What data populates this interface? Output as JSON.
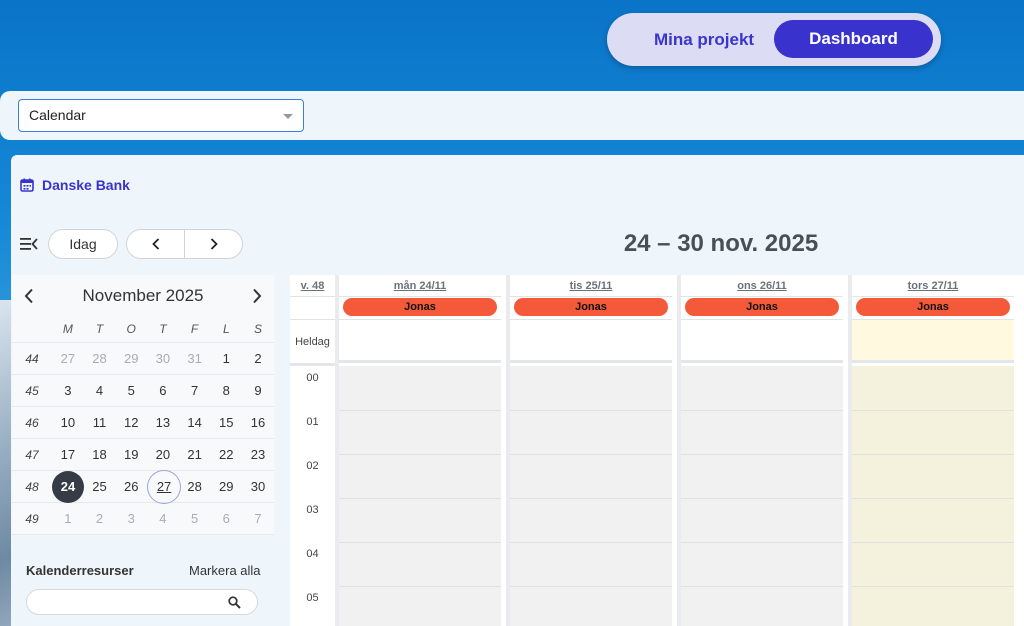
{
  "nav": {
    "projects": "Mina projekt",
    "dashboard": "Dashboard"
  },
  "view_select": {
    "value": "Calendar"
  },
  "org": {
    "name": "Danske Bank"
  },
  "toolbar": {
    "today": "Idag",
    "range_title": "24 – 30 nov. 2025"
  },
  "mini_calendar": {
    "month_label": "November 2025",
    "weekdays": [
      "M",
      "T",
      "O",
      "T",
      "F",
      "L",
      "S"
    ],
    "weeks": [
      {
        "week": "44",
        "days": [
          "27",
          "28",
          "29",
          "30",
          "31",
          "1",
          "2"
        ]
      },
      {
        "week": "45",
        "days": [
          "3",
          "4",
          "5",
          "6",
          "7",
          "8",
          "9"
        ]
      },
      {
        "week": "46",
        "days": [
          "10",
          "11",
          "12",
          "13",
          "14",
          "15",
          "16"
        ]
      },
      {
        "week": "47",
        "days": [
          "17",
          "18",
          "19",
          "20",
          "21",
          "22",
          "23"
        ]
      },
      {
        "week": "48",
        "days": [
          "24",
          "25",
          "26",
          "27",
          "28",
          "29",
          "30"
        ]
      },
      {
        "week": "49",
        "days": [
          "1",
          "2",
          "3",
          "4",
          "5",
          "6",
          "7"
        ]
      }
    ],
    "selected": "24",
    "today": "27"
  },
  "resources": {
    "title": "Kalenderresurser",
    "select_all": "Markera alla"
  },
  "week_view": {
    "week_label": "v. 48",
    "allday_label": "Heldag",
    "days": [
      {
        "label": "mån 24/11",
        "event": "Jonas"
      },
      {
        "label": "tis 25/11",
        "event": "Jonas"
      },
      {
        "label": "ons 26/11",
        "event": "Jonas"
      },
      {
        "label": "tors 27/11",
        "event": "Jonas"
      }
    ],
    "hours": [
      "00",
      "01",
      "02",
      "03",
      "04",
      "05"
    ]
  },
  "colors": {
    "accent": "#3a32cc",
    "event": "#f45a3a",
    "today_bg": "#fff9df"
  }
}
